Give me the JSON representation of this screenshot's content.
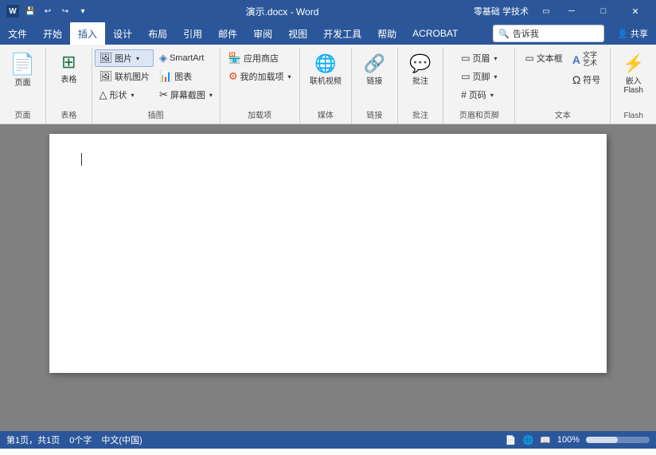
{
  "titlebar": {
    "app_icon": "W",
    "doc_title": "演示.docx - Word",
    "right_info": "零基础 学技术",
    "quick_access": [
      "undo",
      "redo",
      "save",
      "customize"
    ],
    "window_btns": [
      "minimize",
      "restore",
      "close"
    ]
  },
  "menubar": {
    "items": [
      "文件",
      "开始",
      "插入",
      "设计",
      "布局",
      "引用",
      "邮件",
      "审阅",
      "视图",
      "开发工具",
      "帮助",
      "ACROBAT"
    ],
    "active": "插入",
    "tell": "告诉我",
    "share": "共享"
  },
  "ribbon": {
    "groups": [
      {
        "label": "页面",
        "items": [
          {
            "type": "large",
            "icon": "📄",
            "label": "页面"
          }
        ]
      },
      {
        "label": "表格",
        "items": [
          {
            "type": "large",
            "icon": "⊞",
            "label": "表格"
          }
        ]
      },
      {
        "label": "插图",
        "items": [
          {
            "type": "small-highlighted",
            "icon": "🖼",
            "label": "图片"
          },
          {
            "type": "small",
            "icon": "◈",
            "label": "联机图片"
          },
          {
            "type": "small",
            "icon": "△",
            "label": "形状"
          },
          {
            "type": "small",
            "icon": "📊",
            "label": "SmartArt"
          },
          {
            "type": "small",
            "icon": "📈",
            "label": "图表"
          },
          {
            "type": "small",
            "icon": "✂",
            "label": "屏幕截图"
          }
        ]
      },
      {
        "label": "加载项",
        "items": [
          {
            "type": "small",
            "icon": "🏪",
            "label": "应用商店"
          },
          {
            "type": "small",
            "icon": "⚙",
            "label": "我的加载项"
          }
        ]
      },
      {
        "label": "媒体",
        "items": [
          {
            "type": "large",
            "icon": "🎬",
            "label": "联机视频"
          }
        ]
      },
      {
        "label": "链接",
        "items": [
          {
            "type": "large",
            "icon": "🔗",
            "label": "链接"
          }
        ]
      },
      {
        "label": "批注",
        "items": [
          {
            "type": "large",
            "icon": "💬",
            "label": "批注"
          }
        ]
      },
      {
        "label": "页眉和页脚",
        "items": [
          {
            "type": "small",
            "icon": "▭",
            "label": "页眉"
          },
          {
            "type": "small",
            "icon": "▭",
            "label": "页脚"
          },
          {
            "type": "small",
            "icon": "#",
            "label": "页码"
          }
        ]
      },
      {
        "label": "文本",
        "items": [
          {
            "type": "small",
            "icon": "▭",
            "label": "文本框"
          },
          {
            "type": "small",
            "icon": "A",
            "label": "文字"
          },
          {
            "type": "small",
            "icon": "Ω",
            "label": "符号"
          }
        ]
      },
      {
        "label": "Flash",
        "items": [
          {
            "type": "large-red",
            "icon": "⚡",
            "label": "嵌入Flash"
          }
        ]
      }
    ]
  },
  "document": {
    "cursor_visible": true
  },
  "statusbar": {
    "page_info": "第1页，共1页",
    "word_count": "0个字",
    "lang": "中文(中国)",
    "zoom": "100%"
  }
}
